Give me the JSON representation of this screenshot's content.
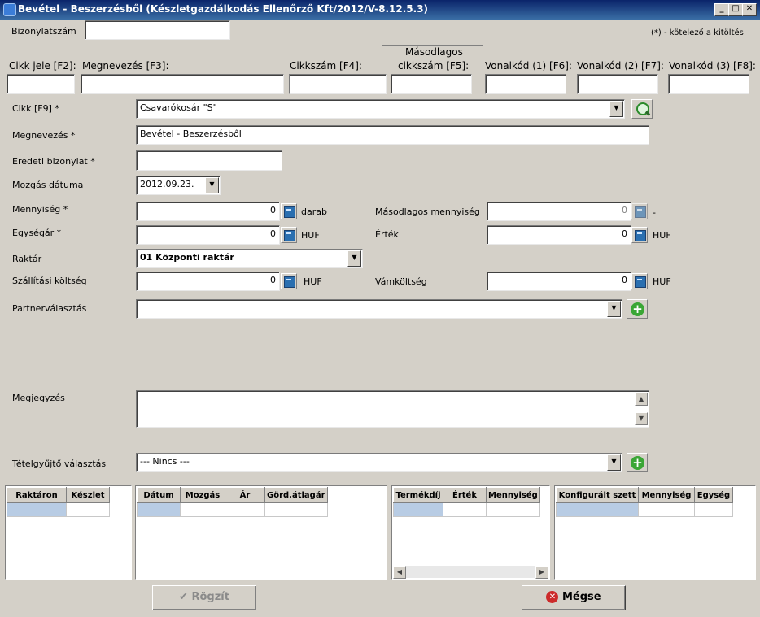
{
  "window": {
    "title": "Bevétel - Beszerzésből (Készletgazdálkodás Ellenőrző Kft/2012/V-8.12.5.3)"
  },
  "top": {
    "doc_label": "Bizonylatszám",
    "doc_value": "",
    "required_note": "(*) - kötelező a kitöltés"
  },
  "search": {
    "headers": {
      "cikk_jele": "Cikk jele [F2]:",
      "megnevezes": "Megnevezés [F3]:",
      "cikkszam": "Cikkszám [F4]:",
      "masodlagos_1": "Másodlagos",
      "masodlagos_2": "cikkszám [F5]:",
      "vonalkod1": "Vonalkód (1) [F6]:",
      "vonalkod2": "Vonalkód (2) [F7]:",
      "vonalkod3": "Vonalkód (3) [F8]:"
    },
    "values": {
      "cikk_jele": "",
      "megnevezes": "",
      "cikkszam": "",
      "masodlagos": "",
      "vonalkod1": "",
      "vonalkod2": "",
      "vonalkod3": ""
    }
  },
  "form": {
    "cikk": {
      "label": "Cikk [F9] *",
      "value": "Csavarókosár \"S\""
    },
    "megnevezes": {
      "label": "Megnevezés *",
      "value": "Bevétel - Beszerzésből"
    },
    "eredeti": {
      "label": "Eredeti bizonylat *",
      "value": ""
    },
    "datum": {
      "label": "Mozgás dátuma",
      "value": "2012.09.23."
    },
    "mennyiseg": {
      "label": "Mennyiség *",
      "value": "0",
      "unit": "darab"
    },
    "masodlagos_menny": {
      "label": "Másodlagos mennyiség",
      "value": "0",
      "unit": "-"
    },
    "egysegar": {
      "label": "Egységár *",
      "value": "0",
      "unit": "HUF"
    },
    "ertek": {
      "label": "Érték",
      "value": "0",
      "unit": "HUF"
    },
    "raktar": {
      "label": "Raktár",
      "value": "01 Központi raktár"
    },
    "szallitasi": {
      "label": "Szállítási költség",
      "value": "0",
      "unit": "HUF"
    },
    "vam": {
      "label": "Vámköltség",
      "value": "0",
      "unit": "HUF"
    },
    "partner": {
      "label": "Partnerválasztás",
      "value": ""
    },
    "megjegyzes": {
      "label": "Megjegyzés",
      "value": ""
    },
    "tetel": {
      "label": "Tételgyűjtő választás",
      "value": "--- Nincs ---"
    }
  },
  "grids": {
    "stock": {
      "headers": [
        "Raktáron",
        "Készlet"
      ]
    },
    "moves": {
      "headers": [
        "Dátum",
        "Mozgás",
        "Ár",
        "Görd.átlagár"
      ]
    },
    "prices": {
      "headers": [
        "Termékdíj",
        "Érték",
        "Mennyiség"
      ]
    },
    "sets": {
      "headers": [
        "Konfigurált szett",
        "Mennyiség",
        "Egység"
      ]
    }
  },
  "buttons": {
    "save": "Rögzít",
    "cancel": "Mégse"
  },
  "colors": {
    "title_bar": "#0a246a",
    "selected_cell": "#b8cce4",
    "add_icon": "#3aa635"
  }
}
